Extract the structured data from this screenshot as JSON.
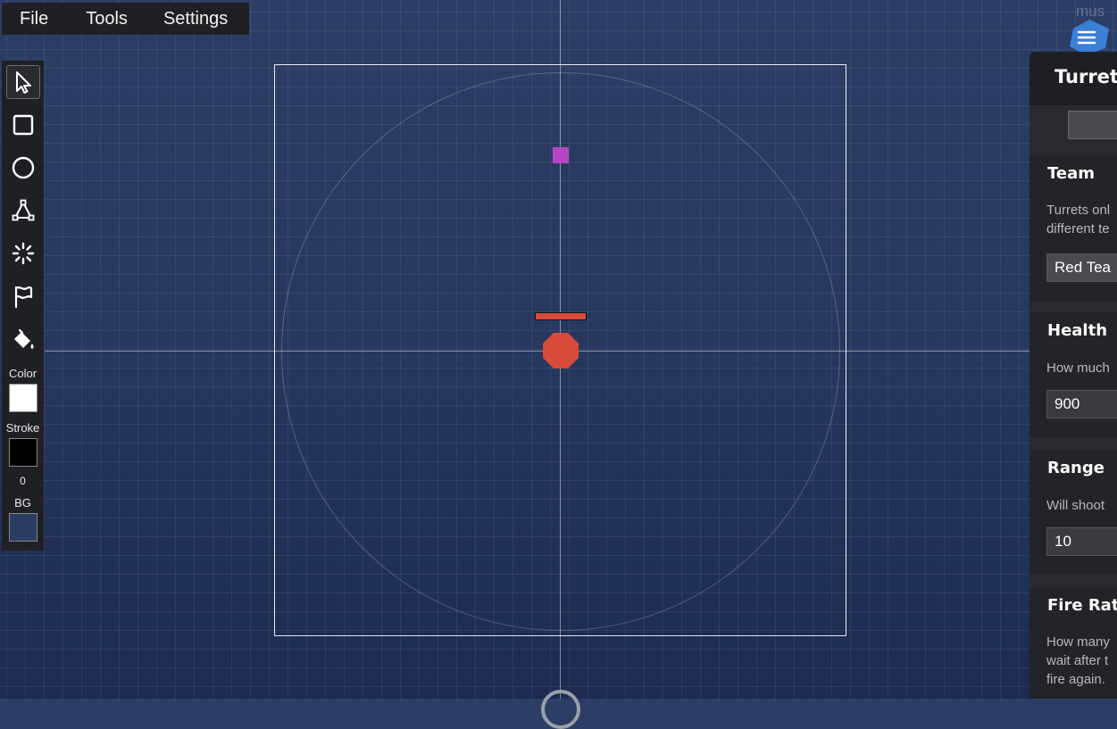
{
  "menubar": {
    "items": [
      "File",
      "Tools",
      "Settings"
    ]
  },
  "toolbar": {
    "tools": [
      "select-tool",
      "rectangle-tool",
      "circle-tool",
      "polygon-tool",
      "spawner-tool",
      "flag-tool",
      "fill-tool"
    ],
    "color_label": "Color",
    "stroke_label": "Stroke",
    "stroke_width": "0",
    "bg_label": "BG",
    "color_value": "#ffffff",
    "stroke_value": "#000000",
    "bg_value": "#2b3c63"
  },
  "logo": {
    "text": "mus"
  },
  "panel": {
    "title": "Turret",
    "team": {
      "title": "Team",
      "desc_line1": "Turrets onl",
      "desc_line2": "different te",
      "value": "Red Tea"
    },
    "health": {
      "title": "Health",
      "desc": "How much",
      "value": "900"
    },
    "range": {
      "title": "Range",
      "desc": "Will shoot",
      "value": "10"
    },
    "fire_rate": {
      "title": "Fire Rate",
      "desc_line1": "How many",
      "desc_line2": "wait after t",
      "desc_line3": "fire again."
    }
  },
  "colors": {
    "turret": "#d84a3a",
    "target": "#b446c4",
    "canvas_bg": "#2b3c63",
    "accent_logo": "#3b7fd6"
  }
}
